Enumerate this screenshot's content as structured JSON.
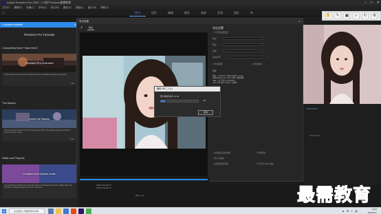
{
  "window": {
    "title": "Adobe Premiere Pro 2020 - C:\\用户\\Videos\\最需教育"
  },
  "menubar": [
    "文件(F)",
    "编辑(E)",
    "剪辑(C)",
    "序列(S)",
    "标记(M)",
    "图形(G)",
    "视图(V)",
    "窗口(W)",
    "帮助(H)"
  ],
  "workspaces": [
    "学习",
    "组件",
    "编辑",
    "颜色",
    "效果",
    "音频",
    "图形",
    "库"
  ],
  "active_workspace": "学习",
  "learn_panel": {
    "updates_label": "4 updates available",
    "close": "✕",
    "title": "Premiere Pro Tutorials",
    "section_new": "Completely New? Start Here!",
    "card1": {
      "thumb": "Premiere Pro Overview",
      "desc": "A two-minute overview of the interface and the essentials needed to get started.",
      "duration": "2 min"
    },
    "section_basics": "The Basics",
    "card2": {
      "thumb": "Learn the Basics",
      "desc": "Four interactive tutorials that cover each step of the video editing process needed to create your first movie.",
      "duration": "8 min"
    },
    "section_skills": "Skills and Projects",
    "card3": {
      "thumb": "Creative and Stylistic Edits",
      "desc": "Five interactive tutorials that teach the basics of adjusting clip speed, adding titles and transitions, adjusting audio, and color correction."
    }
  },
  "export_dialog": {
    "title": "导出设置",
    "close": "✕",
    "tabs": [
      "源",
      "输出"
    ],
    "settings_title": "导出设置",
    "rows": [
      "与序列设置匹配",
      "格式：",
      "预设：",
      "注释：",
      "输出名称：",
      "导出视频",
      "导出音频",
      "摘要"
    ],
    "summary": "输出：C:\\Users\\...\\Videos\\0617_1.mp4\n1080x1920 (1.0), 30 fps, 逐行, 硬件编码\nVBR, 1 次, 目标 10.00 Mbps\nAAC, 320 kbps, 48 kHz, 立体声",
    "checkboxes": [
      "使用最高渲染质量",
      "使用预览",
      "导入项目中",
      "设置开始时间码",
      "仅渲染 Alpha 通道"
    ]
  },
  "progress_dialog": {
    "title": "编码 0617_1 (1)",
    "text": "预计剩余时间: 00:00",
    "percent_text": "3%",
    "percent_value": 0.03,
    "cancel": "取消"
  },
  "right_panel": {
    "timecode1": "00;00;03;22",
    "timecode2": "00;00;03;22"
  },
  "project": {
    "items": [
      "Adobe Premiere Pr",
      "Adobe Premiere Pr"
    ],
    "sequence": "0617_1 (1)"
  },
  "watermark": "最需教育",
  "taskbar": {
    "search_placeholder": "在这里输入你要搜索的内容",
    "time": "14:15",
    "date": "2021/6/17"
  },
  "colors": {
    "accent": "#2d8ceb",
    "watermark": "#1b3f9c"
  }
}
